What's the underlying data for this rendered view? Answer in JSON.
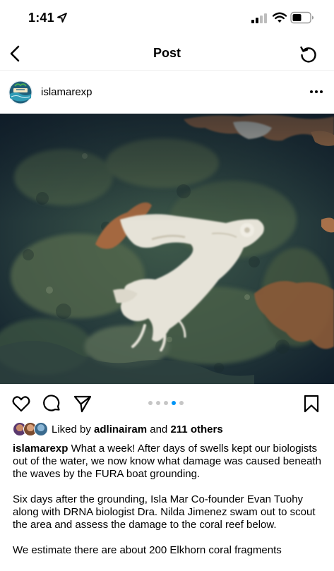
{
  "status_bar": {
    "time": "1:41",
    "icons": [
      "location-arrow-icon",
      "cellular-signal-icon",
      "wifi-icon",
      "battery-icon"
    ]
  },
  "nav": {
    "title": "Post",
    "back_icon": "chevron-left-icon",
    "refresh_icon": "refresh-icon"
  },
  "post": {
    "username": "islamarexp",
    "more_icon": "more-horizontal-icon",
    "carousel": {
      "count": 5,
      "active_index": 3
    },
    "likes": {
      "prefix": "Liked by",
      "first_user": "adlinairam",
      "connector": "and",
      "others": "211 others"
    },
    "caption": {
      "username": "islamarexp",
      "paragraphs": [
        "What a week!  After days of swells kept our biologists out of the water, we now know what damage was caused beneath the waves by the FURA boat grounding.",
        "Six days after the grounding, Isla Mar Co-founder Evan Tuohy along with DRNA biologist Dra. Nilda Jimenez swam out to scout the area and assess the damage to the coral reef below.",
        "We estimate there are about 200 Elkhorn coral fragments"
      ]
    }
  },
  "colors": {
    "accent": "#0095f6",
    "inactive_dot": "#c6c6c6",
    "divider": "#efefef"
  }
}
